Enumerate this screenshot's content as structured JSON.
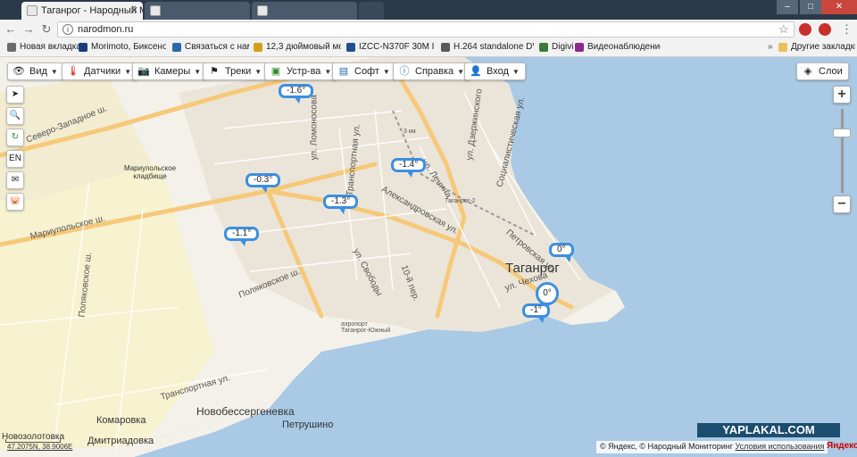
{
  "browser": {
    "tabs": [
      {
        "title": "Таганрог - Народный М",
        "active": true
      },
      {
        "title": "",
        "active": false
      },
      {
        "title": "",
        "active": false
      }
    ],
    "address": "narodmon.ru",
    "bookmarks": [
      {
        "label": "Новая вкладка",
        "color": "#6b6b6b"
      },
      {
        "label": "Morimoto, Биксенон",
        "color": "#1a3d7c"
      },
      {
        "label": "Связаться с нами",
        "color": "#2a6aa8"
      },
      {
        "label": "12,3 дюймовый мон",
        "color": "#d4a017"
      },
      {
        "label": "IZCC-N370F 30M IR V",
        "color": "#1f4f8f"
      },
      {
        "label": "H.264 standalone DVI",
        "color": "#5a5a5a"
      },
      {
        "label": "Digivi",
        "color": "#3a7a3a"
      },
      {
        "label": "Видеонаблюдение а",
        "color": "#8a2a8a"
      }
    ],
    "other_bookmarks": "Другие закладки"
  },
  "toolbar": {
    "view": {
      "label": "Вид",
      "icon": "eye-icon"
    },
    "sensors": {
      "label": "Датчики",
      "icon": "thermometer-icon"
    },
    "cameras": {
      "label": "Камеры",
      "icon": "camera-icon"
    },
    "tracks": {
      "label": "Треки",
      "icon": "flag-icon"
    },
    "devices": {
      "label": "Устр-ва",
      "icon": "device-icon"
    },
    "software": {
      "label": "Софт",
      "icon": "folder-icon"
    },
    "help": {
      "label": "Справка",
      "icon": "info-icon"
    },
    "login": {
      "label": "Вход",
      "icon": "user-icon"
    },
    "layers": {
      "label": "Слои",
      "icon": "layers-icon"
    }
  },
  "side": {
    "lang": "EN"
  },
  "zoom": {
    "plus": "+",
    "minus": "−"
  },
  "markers": [
    {
      "label": "-1.6°"
    },
    {
      "label": "-1.4°"
    },
    {
      "label": "-0.3°"
    },
    {
      "label": "-1.3°"
    },
    {
      "label": "-1.1°"
    },
    {
      "label": "0°"
    },
    {
      "label": "0°"
    },
    {
      "label": "-1°"
    }
  ],
  "places": {
    "city": "Таганрог",
    "mariupol_cemetery": "Мариупольское кладбище",
    "novobessergenevka": "Новобессергеневка",
    "komarovka": "Комаровка",
    "petrushino": "Петрушино",
    "dmitriadovka": "Дмитриадовка",
    "novozolotovka": "Новозолотовка",
    "airport": "аэропорт Таганрог-Южный",
    "station": "Таганрог-2",
    "km3": "3 км"
  },
  "streets": {
    "severo_zapadnoe": "Северо-Западное ш.",
    "mariupolskoe": "Мариупольское ш.",
    "lomonosova": "ул. Ломоносова",
    "transportnaya": "Транспортная ул.",
    "lenina": "ул. Ленина",
    "dzerzhinskogo": "ул. Дзержинского",
    "socialisticheskaya": "Социалистическая ул.",
    "aleksandrovskaya": "Александровская ул.",
    "petrovskaya": "Петровская ул.",
    "svobody": "ул. Свободы",
    "per10": "10-й пер.",
    "chekhova": "ул. Чехова",
    "polyakovskoe": "Поляковское ш.",
    "polyakovskoe2": "Поляковское ш.",
    "transportnaya2": "Транспортная ул."
  },
  "watermark": "YAPLAKAL.COM",
  "copyright": "© Яндекс, © Народный Мониторинг",
  "terms": "Условия использования",
  "yandex": "Яндекс",
  "coords": "47.2075N, 38.9006E",
  "colors": {
    "sea": "#a9c9e4",
    "land": "#f4f1ea",
    "urban": "#e8e2d6",
    "road_major": "#f6c97a",
    "marker_border": "#3c8fe0",
    "field": "#f5f0c8"
  }
}
